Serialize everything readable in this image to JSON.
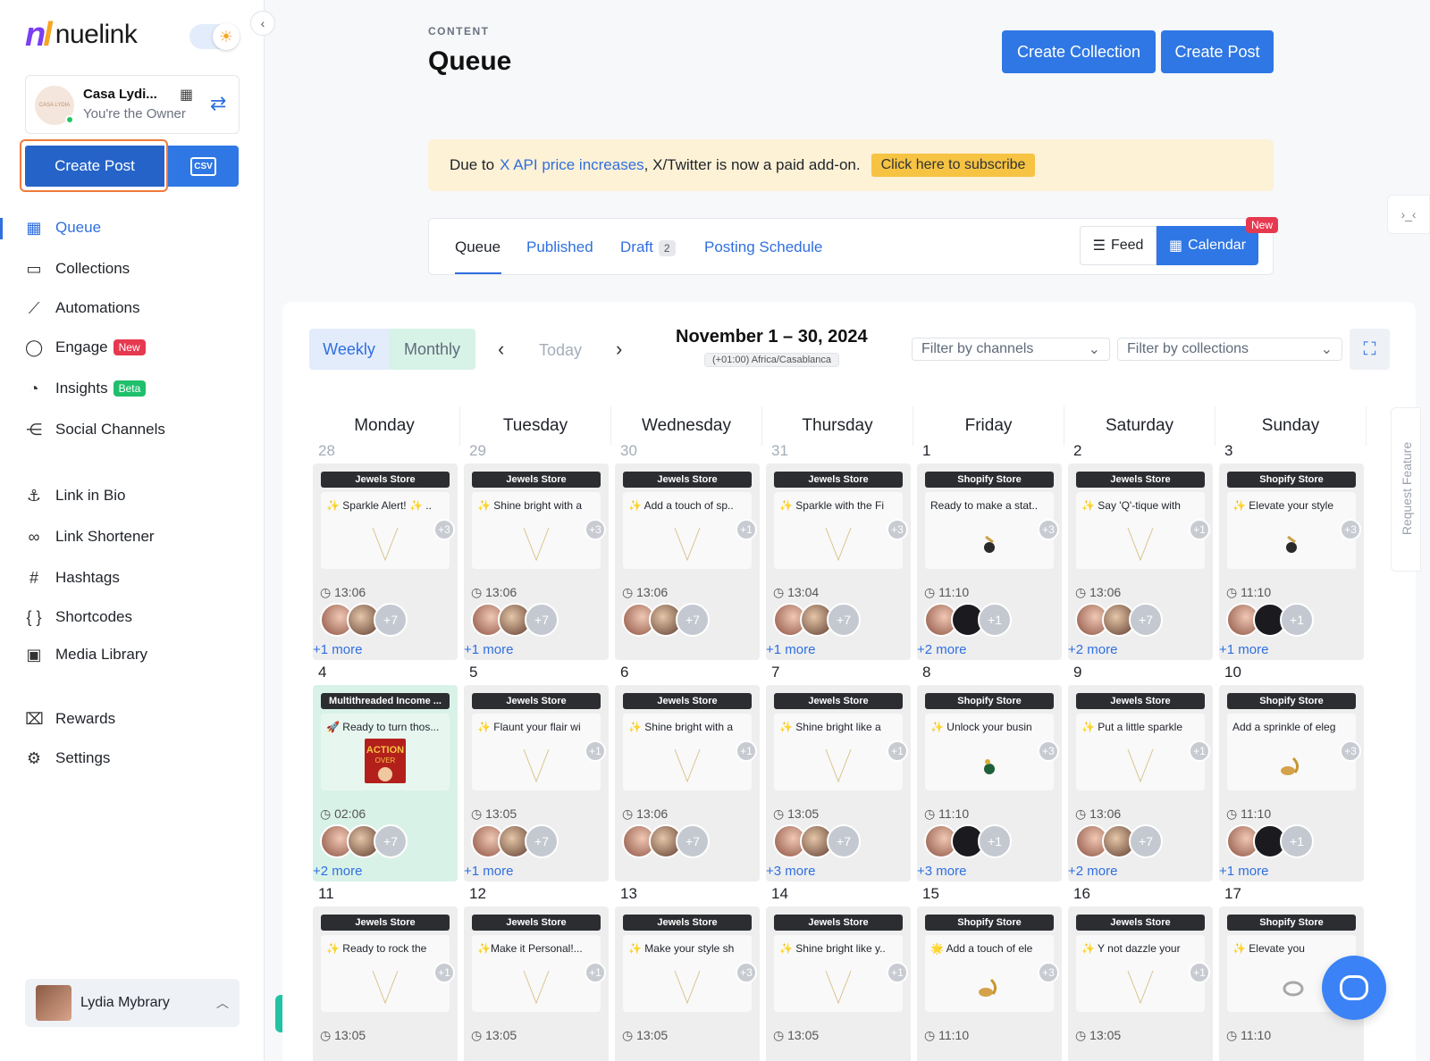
{
  "brand": {
    "name": "nuelink"
  },
  "account": {
    "name": "Casa Lydi...",
    "role": "You're the Owner",
    "avatar_text": "CASA LYDIA"
  },
  "sidebar": {
    "create_post": "Create Post",
    "csv": "CSV",
    "nav": [
      {
        "label": "Queue",
        "icon": "calendar-icon",
        "glyph": "▦"
      },
      {
        "label": "Collections",
        "icon": "folder-icon",
        "glyph": "▭"
      },
      {
        "label": "Automations",
        "icon": "magic-wand-icon",
        "glyph": "⟋"
      },
      {
        "label": "Engage",
        "icon": "chat-bubble-icon",
        "glyph": "◯",
        "badge": "New"
      },
      {
        "label": "Insights",
        "icon": "pie-chart-icon",
        "glyph": "◔",
        "badge": "Beta"
      },
      {
        "label": "Social Channels",
        "icon": "share-icon",
        "glyph": "⋲"
      },
      {
        "label": "Link in Bio",
        "icon": "anchor-icon",
        "glyph": "⚓"
      },
      {
        "label": "Link Shortener",
        "icon": "link-icon",
        "glyph": "∞"
      },
      {
        "label": "Hashtags",
        "icon": "hashtag-icon",
        "glyph": "#"
      },
      {
        "label": "Shortcodes",
        "icon": "braces-icon",
        "glyph": "{ }"
      },
      {
        "label": "Media Library",
        "icon": "image-icon",
        "glyph": "▣"
      },
      {
        "label": "Rewards",
        "icon": "gift-icon",
        "glyph": "⌧"
      },
      {
        "label": "Settings",
        "icon": "gear-icon",
        "glyph": "⚙"
      }
    ],
    "user": {
      "name": "Lydia Mybrary"
    }
  },
  "header": {
    "section": "CONTENT",
    "title": "Queue",
    "create_collection": "Create Collection",
    "create_post": "Create Post"
  },
  "banner": {
    "prefix": "Due to",
    "link": "X API price increases",
    "suffix": ", X/Twitter is now a paid add-on.",
    "button": "Click here to subscribe"
  },
  "tabs": {
    "items": [
      {
        "label": "Queue"
      },
      {
        "label": "Published"
      },
      {
        "label": "Draft",
        "count": "2"
      },
      {
        "label": "Posting Schedule"
      }
    ],
    "feed": "Feed",
    "calendar": "Calendar",
    "new_badge": "New"
  },
  "calendar": {
    "weekly": "Weekly",
    "monthly": "Monthly",
    "today": "Today",
    "range": "November 1 – 30, 2024",
    "timezone": "(+01:00) Africa/Casablanca",
    "filter_channels": "Filter by channels",
    "filter_collections": "Filter by collections",
    "days": [
      "Monday",
      "Tuesday",
      "Wednesday",
      "Thursday",
      "Friday",
      "Saturday",
      "Sunday"
    ],
    "weeks": [
      {
        "dates": [
          "28",
          "29",
          "30",
          "31",
          "1",
          "2",
          "3"
        ],
        "dim": [
          true,
          true,
          true,
          true,
          false,
          false,
          false
        ],
        "posts": [
          {
            "store": "Jewels Store",
            "text": "✨ Sparkle Alert! ✨ ..",
            "plus": "+3",
            "time": "13:06",
            "img": "necklace",
            "avs": [
              "a",
              "b"
            ],
            "more_av": "+7",
            "more": "+1 more"
          },
          {
            "store": "Jewels Store",
            "text": "✨ Shine bright with a",
            "plus": "+3",
            "time": "13:06",
            "img": "necklace",
            "avs": [
              "a",
              "b"
            ],
            "more_av": "+7",
            "more": "+1 more"
          },
          {
            "store": "Jewels Store",
            "text": "✨ Add a touch of sp..",
            "plus": "+1",
            "time": "13:06",
            "img": "necklace",
            "avs": [
              "a",
              "b"
            ],
            "more_av": "+7",
            "more": ""
          },
          {
            "store": "Jewels Store",
            "text": "✨ Sparkle with the Fi",
            "plus": "+3",
            "time": "13:04",
            "img": "necklace",
            "avs": [
              "a",
              "b"
            ],
            "more_av": "+7",
            "more": "+1 more"
          },
          {
            "store": "Shopify Store",
            "text": "Ready to make a stat..",
            "plus": "+3",
            "time": "11:10",
            "img": "earring",
            "avs": [
              "a",
              "dark"
            ],
            "more_av": "+1",
            "more": "+2 more"
          },
          {
            "store": "Jewels Store",
            "text": "✨ Say 'Q'-tique with",
            "plus": "+1",
            "time": "13:06",
            "img": "necklace",
            "avs": [
              "a",
              "b"
            ],
            "more_av": "+7",
            "more": "+2 more"
          },
          {
            "store": "Shopify Store",
            "text": "✨ Elevate your style",
            "plus": "+3",
            "time": "11:10",
            "img": "earring",
            "avs": [
              "a",
              "dark"
            ],
            "more_av": "+1",
            "more": "+1 more"
          }
        ]
      },
      {
        "dates": [
          "4",
          "5",
          "6",
          "7",
          "8",
          "9",
          "10"
        ],
        "dim": [
          false,
          false,
          false,
          false,
          false,
          false,
          false
        ],
        "posts": [
          {
            "store": "Multithreaded Income ...",
            "text": "🚀 Ready to turn thos...",
            "plus": "",
            "time": "02:06",
            "img": "book",
            "avs": [
              "a",
              "b"
            ],
            "more_av": "+7",
            "more": "+2 more",
            "green": true
          },
          {
            "store": "Jewels Store",
            "text": "✨ Flaunt your flair wi",
            "plus": "+1",
            "time": "13:05",
            "img": "necklace",
            "avs": [
              "a",
              "b"
            ],
            "more_av": "+7",
            "more": "+1 more"
          },
          {
            "store": "Jewels Store",
            "text": "✨ Shine bright with a",
            "plus": "+1",
            "time": "13:06",
            "img": "necklace",
            "avs": [
              "a",
              "b"
            ],
            "more_av": "+7",
            "more": ""
          },
          {
            "store": "Jewels Store",
            "text": "✨ Shine bright like a",
            "plus": "+1",
            "time": "13:05",
            "img": "necklace",
            "avs": [
              "a",
              "b"
            ],
            "more_av": "+7",
            "more": "+3 more"
          },
          {
            "store": "Shopify Store",
            "text": "✨ Unlock your busin",
            "plus": "+3",
            "time": "11:10",
            "img": "earring-green",
            "avs": [
              "a",
              "dark"
            ],
            "more_av": "+1",
            "more": "+3 more"
          },
          {
            "store": "Jewels Store",
            "text": "✨ Put a little sparkle",
            "plus": "+1",
            "time": "13:06",
            "img": "necklace",
            "avs": [
              "a",
              "b"
            ],
            "more_av": "+7",
            "more": "+2 more"
          },
          {
            "store": "Shopify Store",
            "text": "Add a sprinkle of eleg",
            "plus": "+3",
            "time": "11:10",
            "img": "earring-gold",
            "avs": [
              "a",
              "dark"
            ],
            "more_av": "+1",
            "more": "+1 more"
          }
        ]
      },
      {
        "dates": [
          "11",
          "12",
          "13",
          "14",
          "15",
          "16",
          "17"
        ],
        "dim": [
          false,
          false,
          false,
          false,
          false,
          false,
          false
        ],
        "posts": [
          {
            "store": "Jewels Store",
            "text": "✨ Ready to rock the",
            "plus": "+1",
            "time": "13:05",
            "img": "necklace"
          },
          {
            "store": "Jewels Store",
            "text": "✨Make it Personal!...",
            "plus": "+1",
            "time": "13:05",
            "img": "necklace"
          },
          {
            "store": "Jewels Store",
            "text": "✨ Make your style sh",
            "plus": "+3",
            "time": "13:05",
            "img": "necklace"
          },
          {
            "store": "Jewels Store",
            "text": "✨ Shine bright like y..",
            "plus": "+1",
            "time": "13:05",
            "img": "necklace"
          },
          {
            "store": "Shopify Store",
            "text": "🌟 Add a touch of ele",
            "plus": "+3",
            "time": "11:10",
            "img": "earring-gold"
          },
          {
            "store": "Jewels Store",
            "text": "✨ Y not dazzle your",
            "plus": "+1",
            "time": "13:05",
            "img": "necklace"
          },
          {
            "store": "Shopify Store",
            "text": "✨ Elevate you",
            "plus": "",
            "time": "11:10",
            "img": "earring-silver"
          }
        ]
      }
    ]
  },
  "right_rail": {
    "request_feature": "Request Feature"
  }
}
